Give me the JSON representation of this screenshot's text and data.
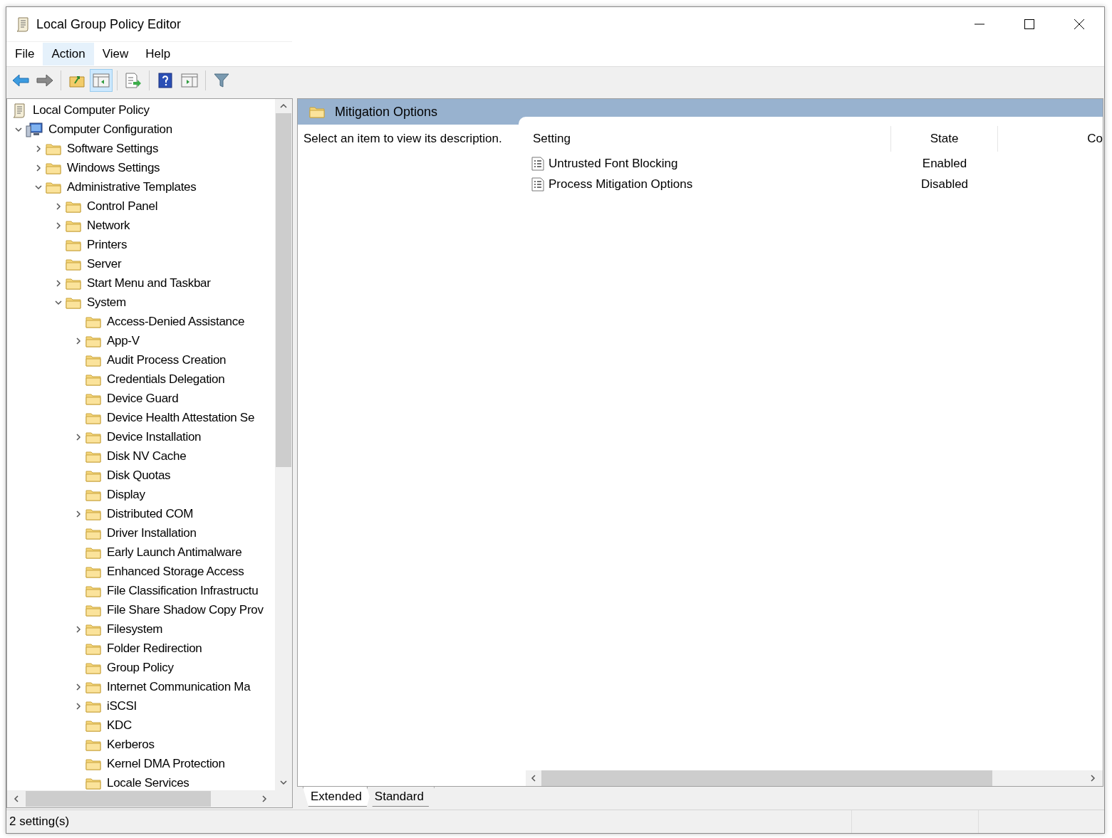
{
  "window": {
    "title": "Local Group Policy Editor"
  },
  "menu": [
    {
      "label": "File",
      "selected": false
    },
    {
      "label": "Action",
      "selected": true
    },
    {
      "label": "View",
      "selected": false
    },
    {
      "label": "Help",
      "selected": false
    }
  ],
  "toolbar": [
    {
      "kind": "back",
      "pressed": false
    },
    {
      "kind": "forward",
      "pressed": false
    },
    {
      "kind": "sep"
    },
    {
      "kind": "up",
      "pressed": false
    },
    {
      "kind": "tree",
      "pressed": true
    },
    {
      "kind": "sep"
    },
    {
      "kind": "export",
      "pressed": false
    },
    {
      "kind": "sep"
    },
    {
      "kind": "help",
      "pressed": false
    },
    {
      "kind": "pane",
      "pressed": false
    },
    {
      "kind": "sep"
    },
    {
      "kind": "filter",
      "pressed": false
    }
  ],
  "tree": [
    {
      "label": "Local Computer Policy",
      "kind": "policy",
      "children": [
        {
          "label": "Computer Configuration",
          "kind": "computer",
          "expanded": true,
          "children": [
            {
              "label": "Software Settings",
              "kind": "folder",
              "expanded": false
            },
            {
              "label": "Windows Settings",
              "kind": "folder",
              "expanded": false
            },
            {
              "label": "Administrative Templates",
              "kind": "folder",
              "expanded": true,
              "children": [
                {
                  "label": "Control Panel",
                  "kind": "folder",
                  "expanded": false
                },
                {
                  "label": "Network",
                  "kind": "folder",
                  "expanded": false
                },
                {
                  "label": "Printers",
                  "kind": "folder"
                },
                {
                  "label": "Server",
                  "kind": "folder"
                },
                {
                  "label": "Start Menu and Taskbar",
                  "kind": "folder",
                  "expanded": false
                },
                {
                  "label": "System",
                  "kind": "folder",
                  "expanded": true,
                  "children": [
                    {
                      "label": "Access-Denied Assistance",
                      "kind": "folder"
                    },
                    {
                      "label": "App-V",
                      "kind": "folder",
                      "expanded": false
                    },
                    {
                      "label": "Audit Process Creation",
                      "kind": "folder"
                    },
                    {
                      "label": "Credentials Delegation",
                      "kind": "folder"
                    },
                    {
                      "label": "Device Guard",
                      "kind": "folder"
                    },
                    {
                      "label": "Device Health Attestation Se",
                      "kind": "folder"
                    },
                    {
                      "label": "Device Installation",
                      "kind": "folder",
                      "expanded": false
                    },
                    {
                      "label": "Disk NV Cache",
                      "kind": "folder"
                    },
                    {
                      "label": "Disk Quotas",
                      "kind": "folder"
                    },
                    {
                      "label": "Display",
                      "kind": "folder"
                    },
                    {
                      "label": "Distributed COM",
                      "kind": "folder",
                      "expanded": false
                    },
                    {
                      "label": "Driver Installation",
                      "kind": "folder"
                    },
                    {
                      "label": "Early Launch Antimalware",
                      "kind": "folder"
                    },
                    {
                      "label": "Enhanced Storage Access",
                      "kind": "folder"
                    },
                    {
                      "label": "File Classification Infrastructu",
                      "kind": "folder"
                    },
                    {
                      "label": "File Share Shadow Copy Prov",
                      "kind": "folder"
                    },
                    {
                      "label": "Filesystem",
                      "kind": "folder",
                      "expanded": false
                    },
                    {
                      "label": "Folder Redirection",
                      "kind": "folder"
                    },
                    {
                      "label": "Group Policy",
                      "kind": "folder"
                    },
                    {
                      "label": "Internet Communication Ma",
                      "kind": "folder",
                      "expanded": false
                    },
                    {
                      "label": "iSCSI",
                      "kind": "folder",
                      "expanded": false
                    },
                    {
                      "label": "KDC",
                      "kind": "folder"
                    },
                    {
                      "label": "Kerberos",
                      "kind": "folder"
                    },
                    {
                      "label": "Kernel DMA Protection",
                      "kind": "folder"
                    },
                    {
                      "label": "Locale Services",
                      "kind": "folder"
                    }
                  ]
                }
              ]
            }
          ]
        }
      ]
    }
  ],
  "details": {
    "title": "Mitigation Options",
    "description": "Select an item to view its description.",
    "columns": [
      "Setting",
      "State",
      "Co"
    ],
    "rows": [
      {
        "setting": "Untrusted Font Blocking",
        "state": "Enabled"
      },
      {
        "setting": "Process Mitigation Options",
        "state": "Disabled"
      }
    ]
  },
  "tabs": [
    {
      "label": "Extended",
      "selected": true
    },
    {
      "label": "Standard",
      "selected": false
    }
  ],
  "status_bar": {
    "text": "2 setting(s)"
  }
}
